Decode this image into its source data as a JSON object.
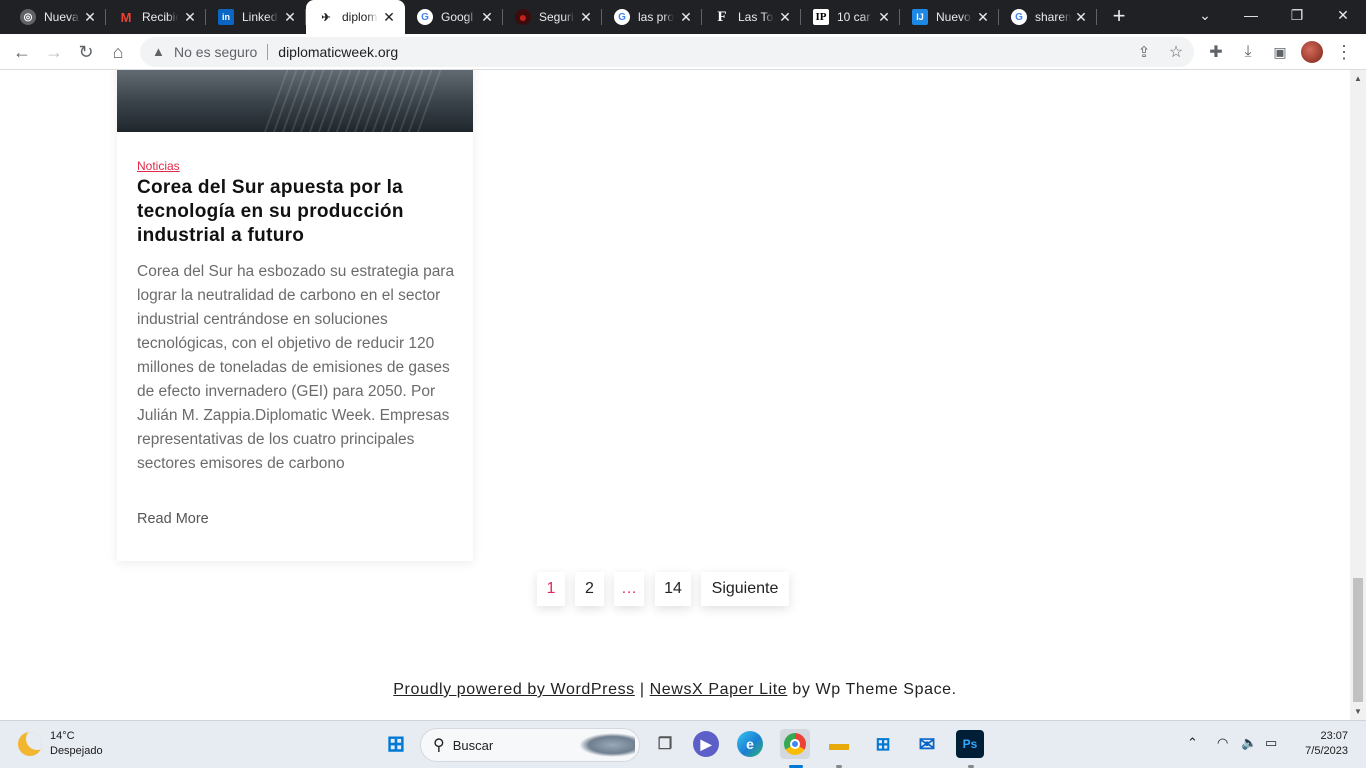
{
  "browser": {
    "tabs": [
      {
        "title": "Nueva",
        "icon": "chrome-icon",
        "color": "#9aa0a6"
      },
      {
        "title": "Recibid",
        "icon": "gmail-icon",
        "color": "#ea4335"
      },
      {
        "title": "Linked",
        "icon": "linkedin-icon",
        "color": "#0a66c2"
      },
      {
        "title": "diplom",
        "icon": "map-icon",
        "color": "#202124",
        "active": true
      },
      {
        "title": "Googl",
        "icon": "google-icon",
        "color": "#4285f4"
      },
      {
        "title": "Seguri",
        "icon": "record-icon",
        "color": "#c5221f"
      },
      {
        "title": "las pro",
        "icon": "google-icon",
        "color": "#4285f4"
      },
      {
        "title": "Las To",
        "icon": "forbes-icon",
        "color": "#ffffff"
      },
      {
        "title": "10 car",
        "icon": "ip-icon",
        "color": "#ffffff"
      },
      {
        "title": "Nuevo",
        "icon": "ij-icon",
        "color": "#1e88e5"
      },
      {
        "title": "sharem",
        "icon": "google-icon",
        "color": "#4285f4"
      }
    ],
    "omnibox": {
      "security_label": "No es seguro",
      "url": "diplomaticweek.org"
    }
  },
  "article": {
    "category": "Noticias",
    "title": "Corea del Sur apuesta por la tecnología en su producción industrial a futuro",
    "excerpt": "Corea del Sur ha esbozado su estrategia para lograr la neutralidad de carbono en el sector industrial centrándose en soluciones tecnológicas, con el objetivo de reducir 120 millones de toneladas de emisiones de gases de efecto invernadero (GEI) para 2050. Por Julián M. Zappia.Diplomatic Week. Empresas representativas de los cuatro principales sectores emisores de carbono",
    "read_more": "Read More"
  },
  "pagination": {
    "pages": [
      "1",
      "2",
      "…",
      "14"
    ],
    "current": "1",
    "next": "Siguiente"
  },
  "footer": {
    "powered": "Proudly powered by WordPress",
    "sep": " | ",
    "theme": "NewsX Paper Lite",
    "by": " by Wp Theme Space."
  },
  "taskbar": {
    "weather_temp": "14°C",
    "weather_desc": "Despejado",
    "search_label": "Buscar",
    "time": "23:07",
    "date": "7/5/2023"
  },
  "colors": {
    "accent": "#e0294a",
    "tab_strip": "#202124"
  }
}
